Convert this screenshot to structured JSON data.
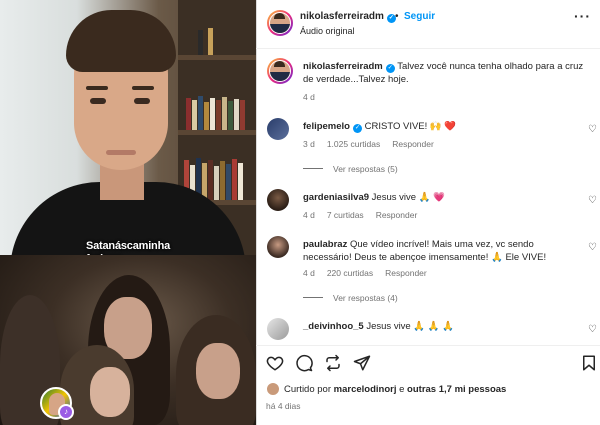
{
  "media": {
    "caption_line1": "Satanáscaminha",
    "caption_line2": "furioso"
  },
  "header": {
    "username": "nikolasferreiradm",
    "separator": "•",
    "follow_label": "Seguir",
    "audio_label": "Áudio original",
    "more_label": "···"
  },
  "post": {
    "username": "nikolasferreiradm",
    "text": "Talvez você nunca tenha olhado para a cruz de verdade...Talvez hoje.",
    "time": "4 d"
  },
  "comments": [
    {
      "username": "felipemelo",
      "verified": true,
      "text": "CRISTO VIVE! 🙌 ❤️",
      "time": "3 d",
      "likes": "1.025 curtidas",
      "reply_label": "Responder",
      "view_replies": "Ver respostas (5)"
    },
    {
      "username": "gardeniasilva9",
      "verified": false,
      "text": "Jesus vive 🙏 💗",
      "time": "4 d",
      "likes": "7 curtidas",
      "reply_label": "Responder"
    },
    {
      "username": "paulabraz",
      "verified": false,
      "text": "Que vídeo incrível! Mais uma vez, vc sendo necessário! Deus te abençoe imensamente! 🙏 Ele VIVE!",
      "time": "4 d",
      "likes": "220 curtidas",
      "reply_label": "Responder",
      "view_replies": "Ver respostas (4)"
    },
    {
      "username": "_deivinhoo_5",
      "verified": false,
      "text": "Jesus vive 🙏 🙏 🙏",
      "time": "",
      "likes": "",
      "reply_label": ""
    }
  ],
  "footer": {
    "liked_prefix": "Curtido por",
    "liked_user": "marcelodinorj",
    "liked_middle": "e",
    "liked_others": "outras 1,7 mi pessoas",
    "time_ago": "há 4 dias"
  },
  "icons": {
    "like": "heart-icon",
    "comment": "comment-icon",
    "repost": "repost-icon",
    "share": "send-icon",
    "save": "bookmark-icon"
  },
  "colors": {
    "accent": "#0095f6",
    "muted": "#737373",
    "heart": "#ed4956"
  }
}
